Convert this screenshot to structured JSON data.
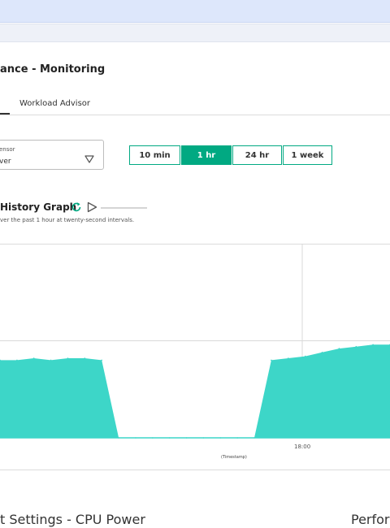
{
  "header": {
    "page_title": "ance - Monitoring"
  },
  "tabs": [
    {
      "label": ""
    },
    {
      "label": "Workload Advisor"
    }
  ],
  "sensor": {
    "label": "ensor",
    "value": "ver"
  },
  "time_range": {
    "options": [
      "10 min",
      "1 hr",
      "24 hr",
      "1 week"
    ],
    "selected": "1 hr"
  },
  "graph": {
    "title": "History Graph",
    "subtitle": "ver the past 1 hour at twenty-second intervals.",
    "refresh_icon": "refresh-icon",
    "play_icon": "play-icon",
    "accent_color": "#01a982",
    "fill_color": "#3dd6c8"
  },
  "chart_data": {
    "type": "area",
    "xlabel": "(Timestamp)",
    "x_ticks": [
      "18:00"
    ],
    "series": [
      {
        "values": [
          0.4,
          0.4,
          0.41,
          0.4,
          0.41,
          0.41,
          0.4,
          0.0,
          0.0,
          0.0,
          0.0,
          0.0,
          0.0,
          0.0,
          0.0,
          0.0,
          0.4,
          0.41,
          0.42,
          0.44,
          0.46,
          0.47,
          0.48,
          0.48
        ]
      }
    ]
  },
  "footer": {
    "left_text": "t Settings - CPU Power",
    "right_text": "Perfor"
  }
}
